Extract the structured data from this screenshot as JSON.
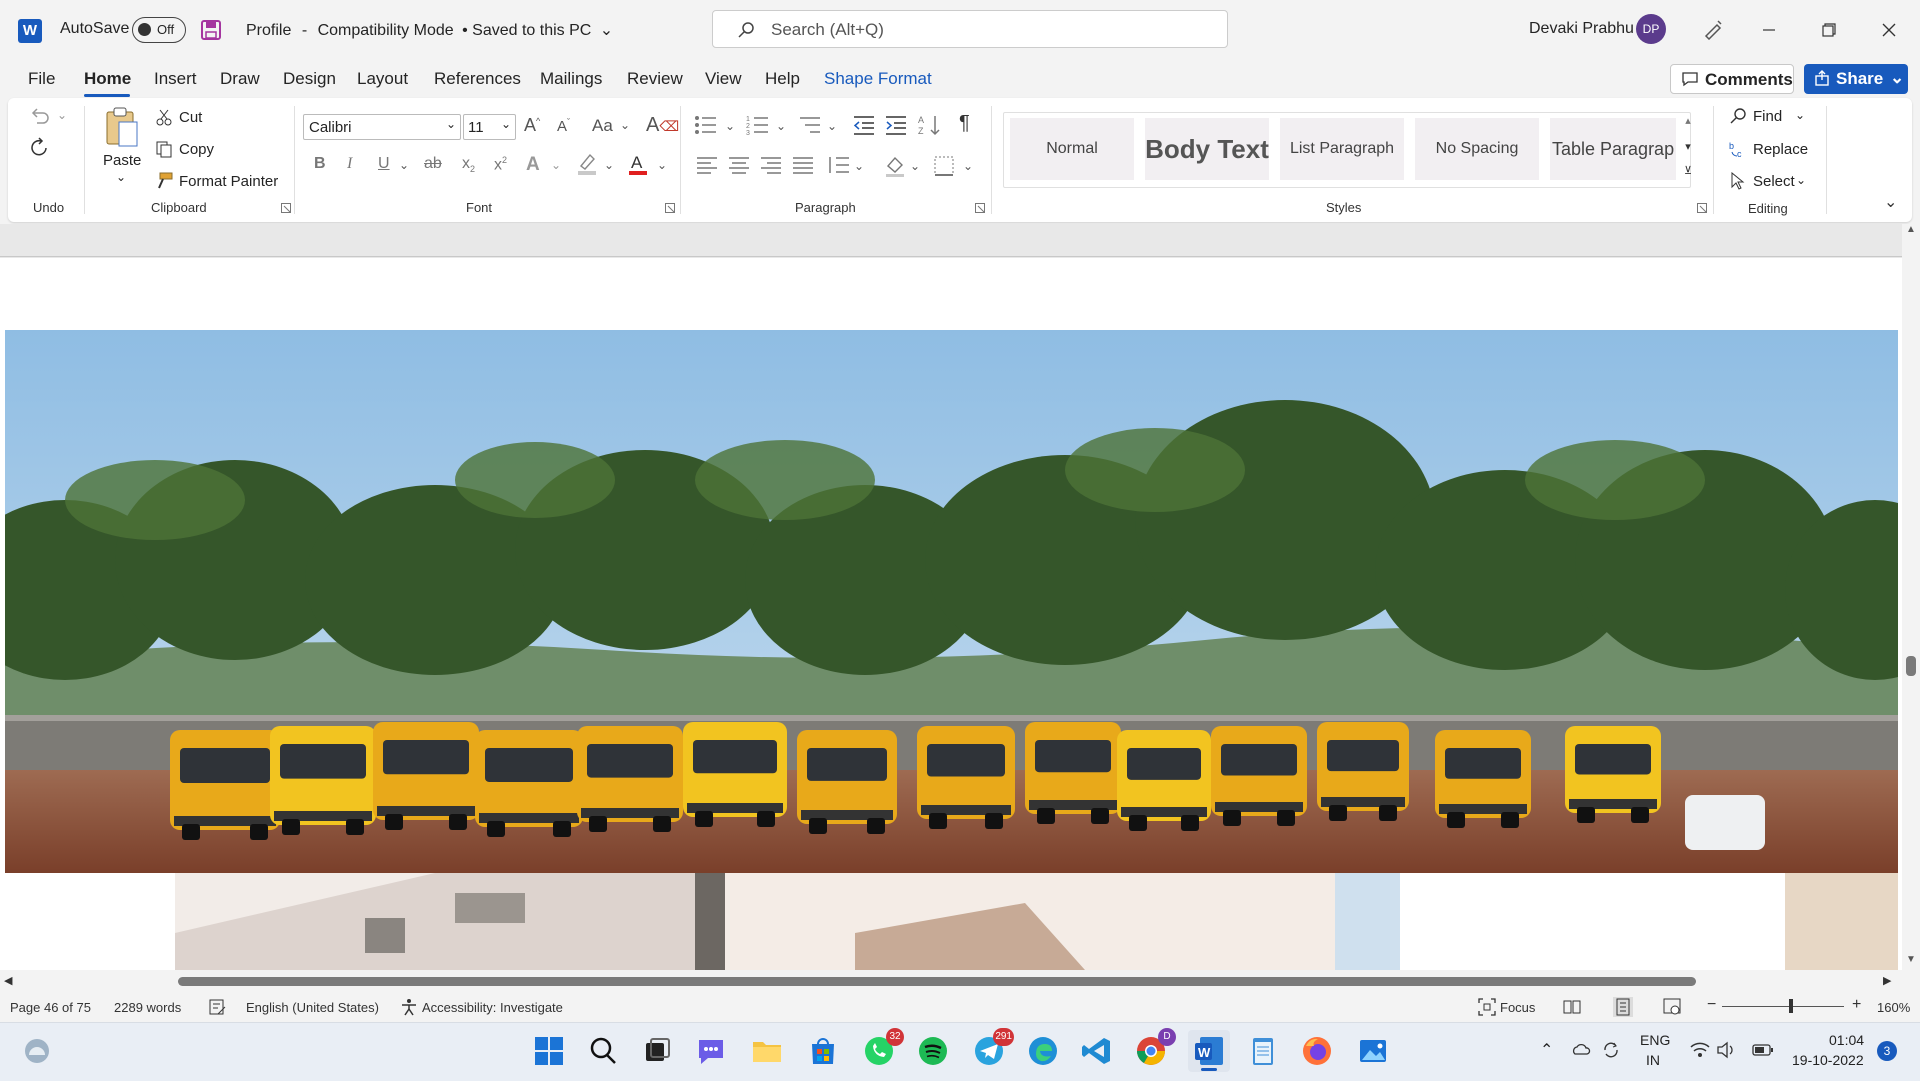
{
  "titlebar": {
    "app_logo": "W",
    "autosave_label": "AutoSave",
    "autosave_state": "Off",
    "document_name": "Profile",
    "separator": "-",
    "mode": "Compatibility Mode",
    "save_status": "• Saved to this PC",
    "search_placeholder": "Search (Alt+Q)",
    "user_name": "Devaki Prabhu",
    "user_initials": "DP"
  },
  "menu": {
    "tabs": [
      "File",
      "Home",
      "Insert",
      "Draw",
      "Design",
      "Layout",
      "References",
      "Mailings",
      "Review",
      "View",
      "Help",
      "Shape Format"
    ],
    "active": "Home",
    "comments_label": "Comments",
    "share_label": "Share"
  },
  "ribbon": {
    "undo_group": "Undo",
    "clipboard": {
      "paste": "Paste",
      "cut": "Cut",
      "copy": "Copy",
      "format_painter": "Format Painter",
      "label": "Clipboard"
    },
    "font": {
      "family": "Calibri",
      "size": "11",
      "label": "Font",
      "case_label": "Aa"
    },
    "paragraph": {
      "label": "Paragraph"
    },
    "styles": {
      "items": [
        "Normal",
        "Body Text",
        "List Paragraph",
        "No Spacing",
        "Table Paragrap"
      ],
      "label": "Styles"
    },
    "editing": {
      "find": "Find",
      "replace": "Replace",
      "select": "Select",
      "label": "Editing"
    }
  },
  "statusbar": {
    "page": "Page 46 of 75",
    "words": "2289 words",
    "language": "English (United States)",
    "accessibility": "Accessibility: Investigate",
    "focus": "Focus",
    "zoom": "160%"
  },
  "taskbar": {
    "whatsapp_badge": "32",
    "telegram_badge": "291",
    "chrome_badge": "D",
    "lang_top": "ENG",
    "lang_bottom": "IN",
    "time": "01:04",
    "date": "19-10-2022",
    "notifications": "3"
  },
  "colors": {
    "accent": "#185abd",
    "bus_yellow": "#e8a91a",
    "sky": "#a7cbe6"
  }
}
